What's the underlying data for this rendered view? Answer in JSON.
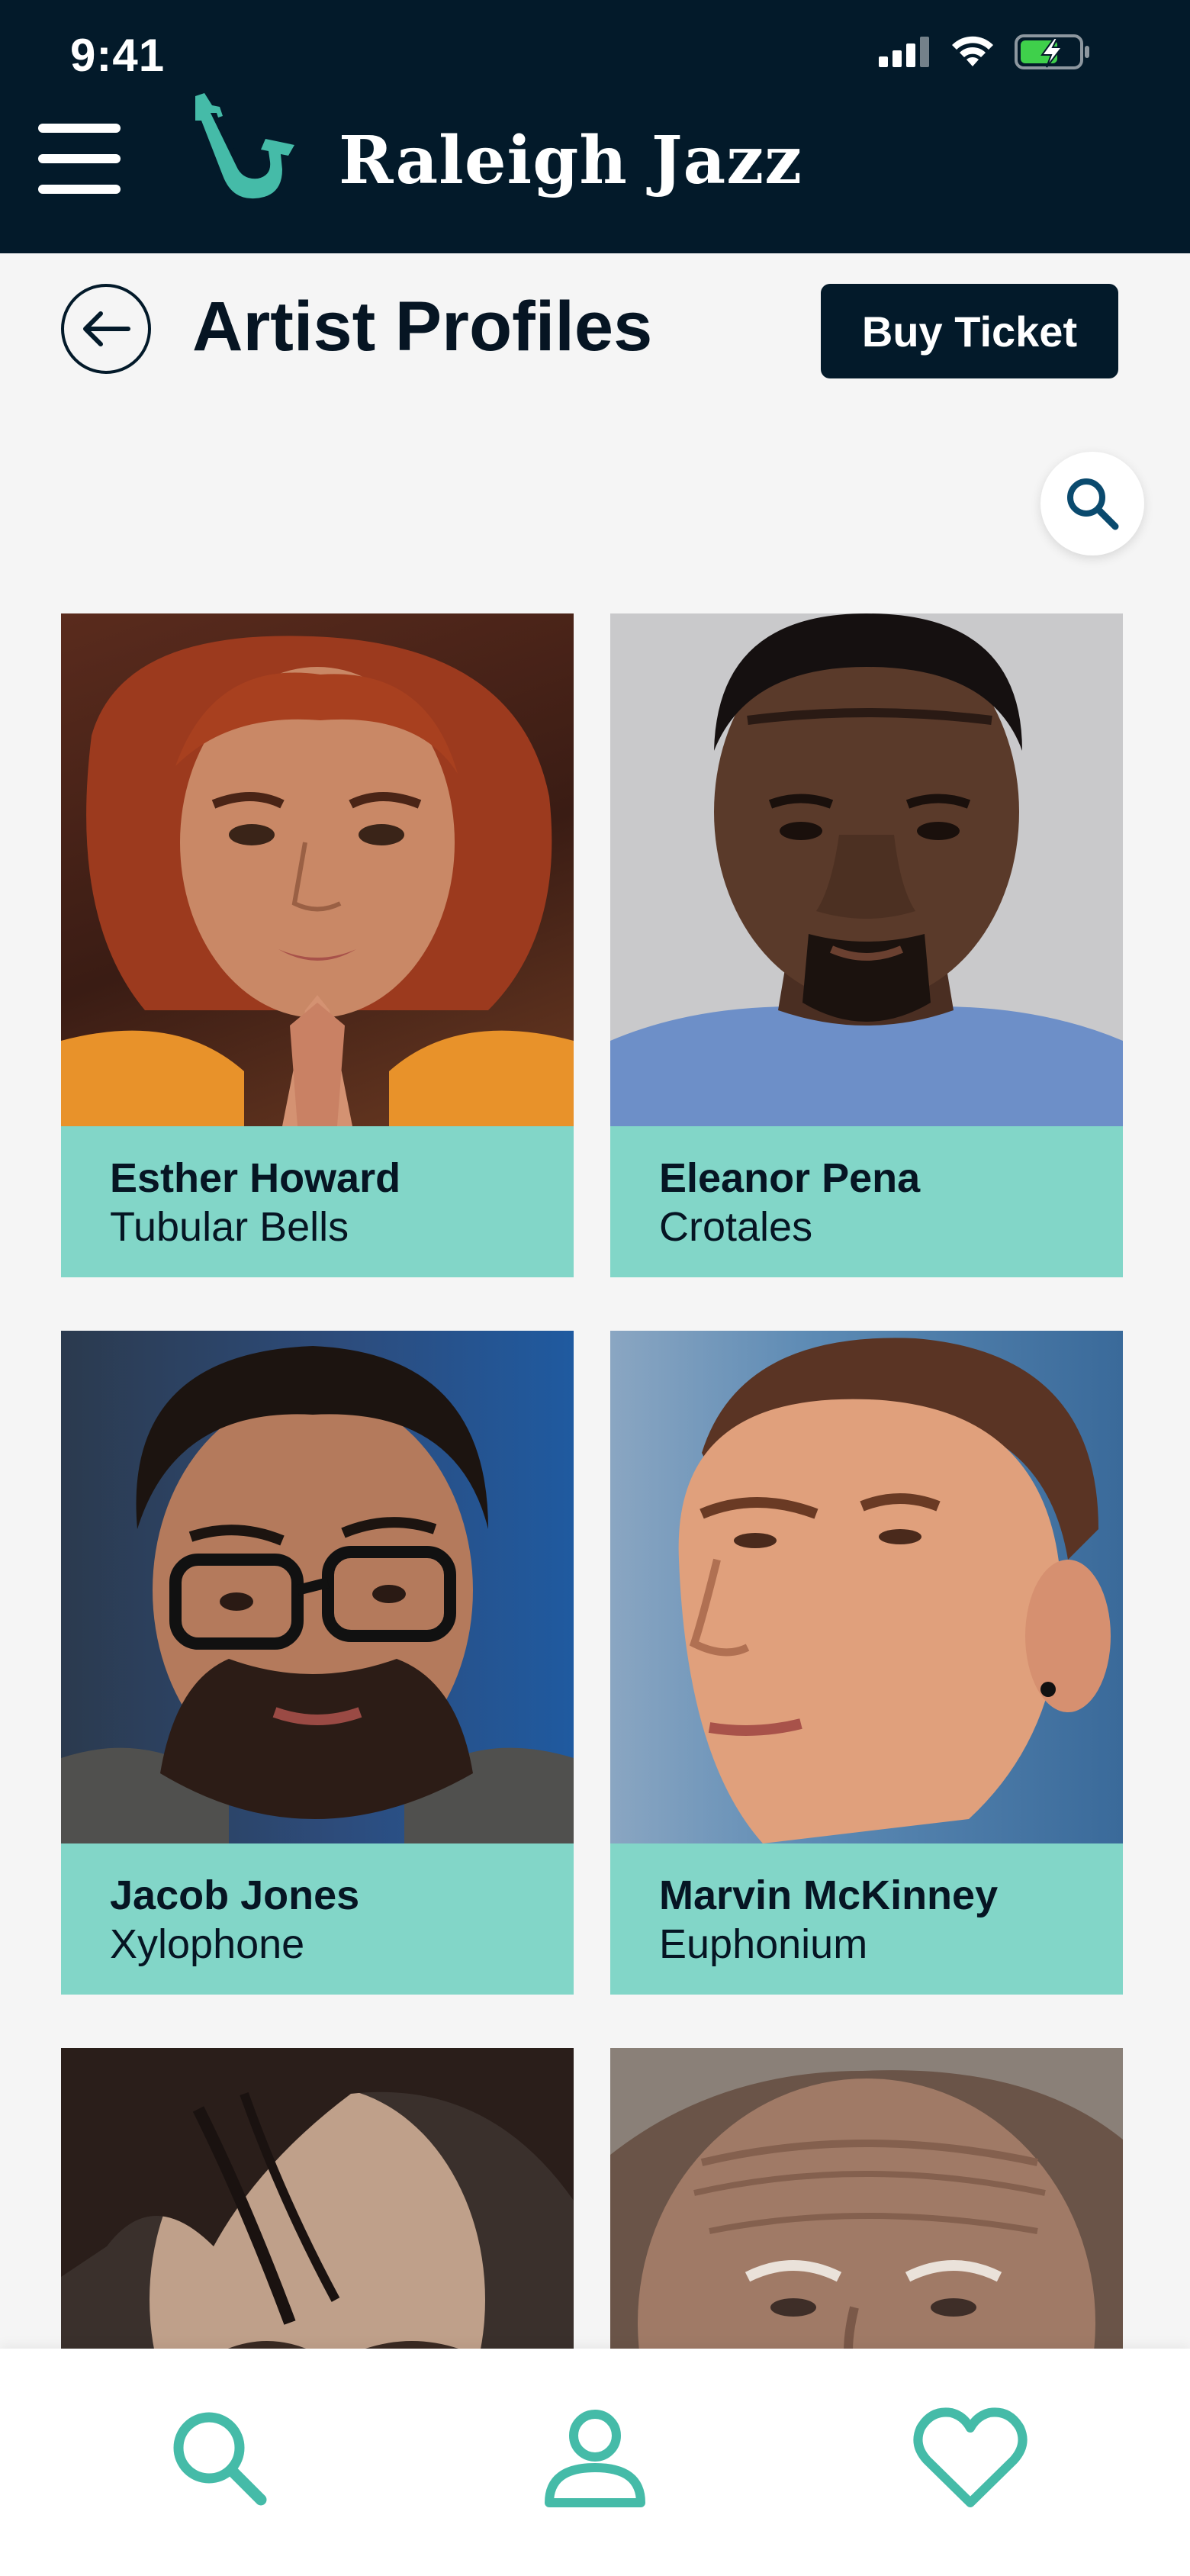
{
  "status_bar": {
    "time": "9:41"
  },
  "header": {
    "brand": "Raleigh Jazz"
  },
  "page": {
    "title": "Artist Profiles",
    "buy_ticket_label": "Buy Ticket"
  },
  "artists": [
    {
      "name": "Esther Howard",
      "instrument": "Tubular Bells"
    },
    {
      "name": "Eleanor Pena",
      "instrument": "Crotales"
    },
    {
      "name": "Jacob Jones",
      "instrument": "Xylophone"
    },
    {
      "name": "Marvin McKinney",
      "instrument": "Euphonium"
    }
  ],
  "colors": {
    "navy": "#031a2a",
    "teal": "#82d6c8",
    "icon_teal": "#45bba8"
  },
  "icons": {
    "menu": "hamburger-icon",
    "logo": "saxophone-icon",
    "back": "arrow-left-icon",
    "search": "search-icon",
    "nav_search": "search-icon",
    "nav_profile": "user-icon",
    "nav_favorites": "heart-icon"
  }
}
